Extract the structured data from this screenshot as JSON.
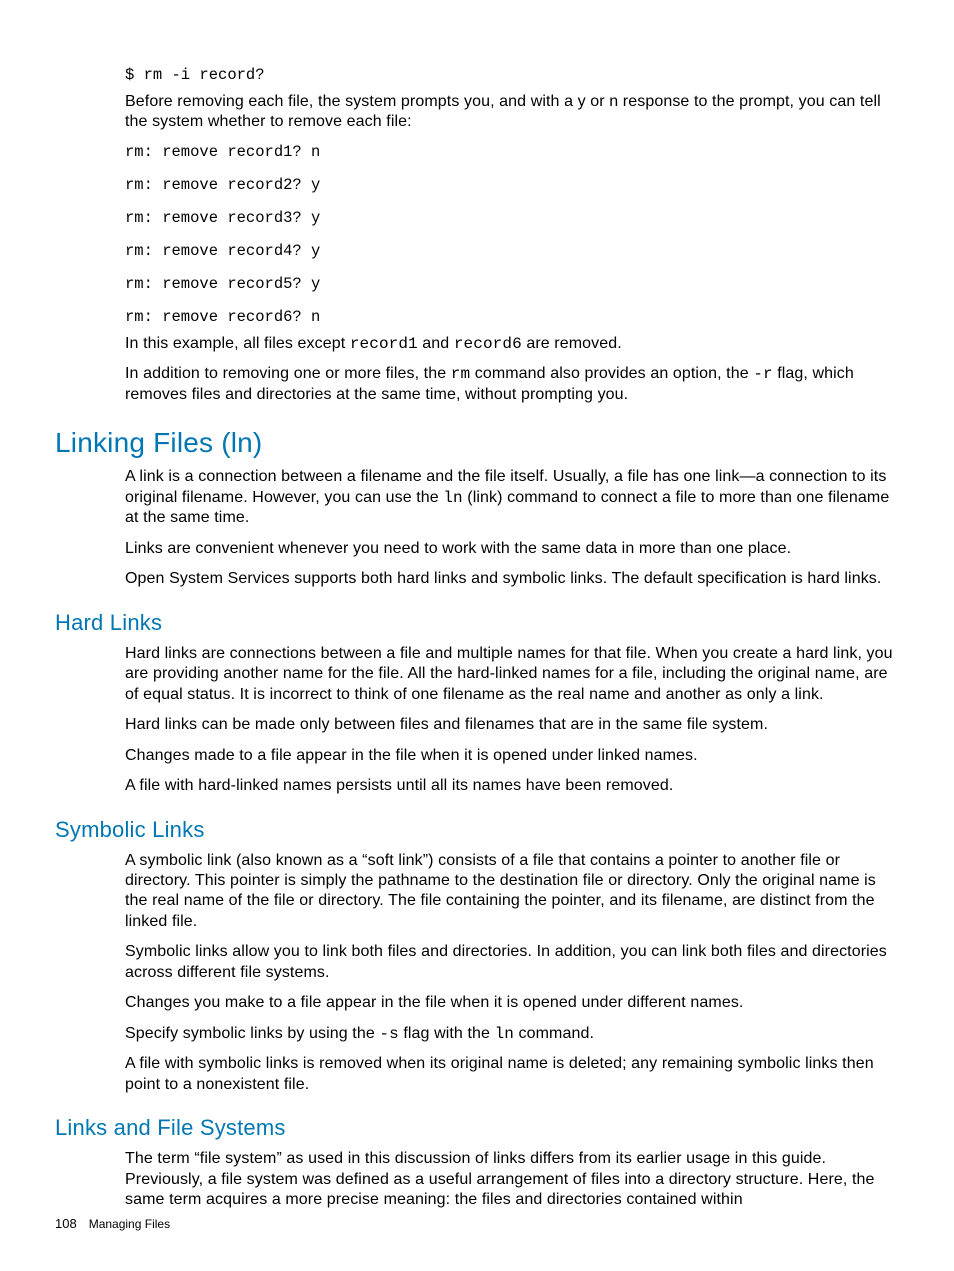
{
  "intro": {
    "cmd": "$ rm -i record?",
    "para1_a": "Before removing each file, the system prompts you, and with a y or n response to the prompt, you can tell the system whether to remove each file:",
    "prompts": [
      "rm: remove record1? n",
      "rm: remove record2? y",
      "rm: remove record3? y",
      "rm: remove record4? y",
      "rm: remove record5? y",
      "rm: remove record6? n"
    ],
    "para2_a": "In this example, all files except ",
    "para2_code1": "record1",
    "para2_b": " and ",
    "para2_code2": "record6",
    "para2_c": " are removed.",
    "para3_a": "In addition to removing one or more files, the ",
    "para3_code1": "rm",
    "para3_b": " command also provides an option, the ",
    "para3_code2": "-r",
    "para3_c": " flag, which removes files and directories at the same time, without prompting you."
  },
  "linking": {
    "title": "Linking Files (ln)",
    "para1_a": "A link is a connection between a filename and the file itself. Usually, a file has one link—a connection to its original filename. However, you can use the ",
    "para1_code1": "ln",
    "para1_b": " (link) command to connect a file to more than one filename at the same time.",
    "para2": "Links are convenient whenever you need to work with the same data in more than one place.",
    "para3": "Open System Services supports both hard links and symbolic links. The default specification is hard links."
  },
  "hardlinks": {
    "title": "Hard Links",
    "para1": "Hard links are connections between a file and multiple names for that file. When you create a hard link, you are providing another name for the file. All the hard-linked names for a file, including the original name, are of equal status. It is incorrect to think of one filename as the real name and another as only a link.",
    "para2": "Hard links can be made only between files and filenames that are in the same file system.",
    "para3": "Changes made to a file appear in the file when it is opened under linked names.",
    "para4": "A file with hard-linked names persists until all its names have been removed."
  },
  "symlinks": {
    "title": "Symbolic Links",
    "para1": "A symbolic link (also known as a “soft link”) consists of a file that contains a pointer to another file or directory. This pointer is simply the pathname to the destination file or directory. Only the original name is the real name of the file or directory. The file containing the pointer, and its filename, are distinct from the linked file.",
    "para2": "Symbolic links allow you to link both files and directories. In addition, you can link both files and directories across different file systems.",
    "para3": "Changes you make to a file appear in the file when it is opened under different names.",
    "para4_a": "Specify symbolic links by using the ",
    "para4_code1": "-s",
    "para4_b": " flag with the ",
    "para4_code2": "ln",
    "para4_c": " command.",
    "para5": "A file with symbolic links is removed when its original name is deleted; any remaining symbolic links then point to a nonexistent file."
  },
  "linksfs": {
    "title": "Links and File Systems",
    "para1": "The term “file system” as used in this discussion of links differs from its earlier usage in this guide. Previously, a file system was defined as a useful arrangement of files into a directory structure. Here, the same term acquires a more precise meaning: the files and directories contained within"
  },
  "footer": {
    "page": "108",
    "section": "Managing Files"
  }
}
